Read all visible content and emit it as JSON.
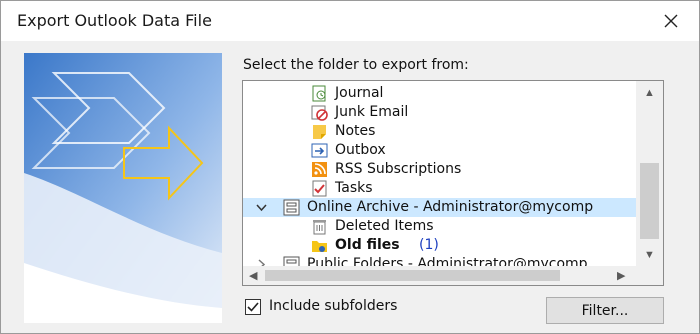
{
  "window": {
    "title": "Export Outlook Data File"
  },
  "prompt": "Select the folder to export from:",
  "tree": {
    "items": [
      {
        "label": "Journal",
        "icon": "journal-icon"
      },
      {
        "label": "Junk Email",
        "icon": "junk-email-icon"
      },
      {
        "label": "Notes",
        "icon": "notes-icon"
      },
      {
        "label": "Outbox",
        "icon": "outbox-icon"
      },
      {
        "label": "RSS Subscriptions",
        "icon": "rss-icon"
      },
      {
        "label": "Tasks",
        "icon": "tasks-icon"
      },
      {
        "label": "Online Archive - Administrator@mycomp",
        "icon": "mailbox-icon",
        "expanded": true,
        "selected": true
      },
      {
        "label": "Deleted Items",
        "icon": "deleted-items-icon"
      },
      {
        "label": "Old files",
        "icon": "folder-icon",
        "count": "(1)",
        "bold": true
      },
      {
        "label": "Public Folders - Administrator@mycomp",
        "icon": "public-folders-icon",
        "expanded": false
      }
    ]
  },
  "include_subfolders": {
    "label": "Include subfolders",
    "checked": true
  },
  "filter_button": {
    "label": "Filter..."
  },
  "colors": {
    "selection": "#cce8ff",
    "count": "#1d3fbf",
    "accent_yellow": "#f5c518",
    "art_blue": "#2e63b4"
  }
}
